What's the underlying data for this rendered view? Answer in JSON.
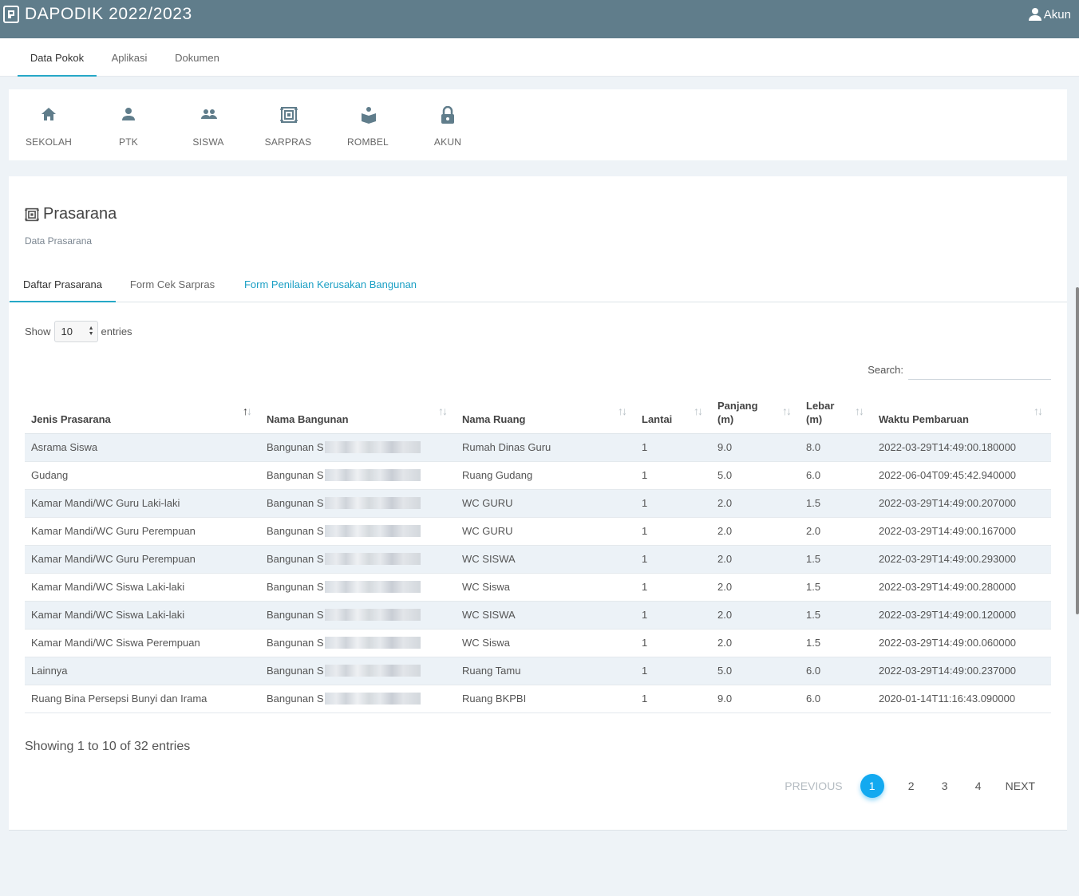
{
  "app": {
    "title": "DAPODIK 2022/2023",
    "account_label": "Akun",
    "colors": {
      "topbar": "#607d8b",
      "accent": "#26a8c7",
      "link": "#1a9fc4",
      "page_current": "#13a9f0"
    }
  },
  "menu": [
    {
      "label": "Data Pokok",
      "active": true
    },
    {
      "label": "Aplikasi",
      "active": false
    },
    {
      "label": "Dokumen",
      "active": false
    }
  ],
  "modules": [
    {
      "label": "SEKOLAH",
      "icon": "home-icon"
    },
    {
      "label": "PTK",
      "icon": "person-icon"
    },
    {
      "label": "SISWA",
      "icon": "people-icon"
    },
    {
      "label": "SARPRAS",
      "icon": "sarpras-icon"
    },
    {
      "label": "ROMBEL",
      "icon": "book-reader-icon"
    },
    {
      "label": "AKUN",
      "icon": "lock-icon"
    }
  ],
  "page": {
    "title": "Prasarana",
    "subtitle": "Data Prasarana"
  },
  "tabs": [
    {
      "label": "Daftar Prasarana",
      "active": true
    },
    {
      "label": "Form Cek Sarpras",
      "active": false
    },
    {
      "label": "Form Penilaian Kerusakan Bangunan",
      "active": false
    }
  ],
  "table_controls": {
    "show_label": "Show",
    "entries_value": "10",
    "entries_label": "entries",
    "search_label": "Search:",
    "search_value": ""
  },
  "table": {
    "columns": [
      "Jenis Prasarana",
      "Nama Bangunan",
      "Nama Ruang",
      "Lantai",
      "Panjang (m)",
      "Lebar (m)",
      "Waktu Pembaruan"
    ],
    "rows": [
      [
        "Asrama Siswa",
        "Bangunan S",
        "Rumah Dinas Guru",
        "1",
        "9.0",
        "8.0",
        "2022-03-29T14:49:00.180000"
      ],
      [
        "Gudang",
        "Bangunan S",
        "Ruang Gudang",
        "1",
        "5.0",
        "6.0",
        "2022-06-04T09:45:42.940000"
      ],
      [
        "Kamar Mandi/WC Guru Laki-laki",
        "Bangunan S",
        "WC GURU",
        "1",
        "2.0",
        "1.5",
        "2022-03-29T14:49:00.207000"
      ],
      [
        "Kamar Mandi/WC Guru Perempuan",
        "Bangunan S",
        "WC GURU",
        "1",
        "2.0",
        "2.0",
        "2022-03-29T14:49:00.167000"
      ],
      [
        "Kamar Mandi/WC Guru Perempuan",
        "Bangunan S",
        "WC SISWA",
        "1",
        "2.0",
        "1.5",
        "2022-03-29T14:49:00.293000"
      ],
      [
        "Kamar Mandi/WC Siswa Laki-laki",
        "Bangunan S",
        "WC Siswa",
        "1",
        "2.0",
        "1.5",
        "2022-03-29T14:49:00.280000"
      ],
      [
        "Kamar Mandi/WC Siswa Laki-laki",
        "Bangunan S",
        "WC SISWA",
        "1",
        "2.0",
        "1.5",
        "2022-03-29T14:49:00.120000"
      ],
      [
        "Kamar Mandi/WC Siswa Perempuan",
        "Bangunan S",
        "WC Siswa",
        "1",
        "2.0",
        "1.5",
        "2022-03-29T14:49:00.060000"
      ],
      [
        "Lainnya",
        "Bangunan S",
        "Ruang Tamu",
        "1",
        "5.0",
        "6.0",
        "2022-03-29T14:49:00.237000"
      ],
      [
        "Ruang Bina Persepsi Bunyi dan Irama",
        "Bangunan S",
        "Ruang BKPBI",
        "1",
        "9.0",
        "6.0",
        "2020-01-14T11:16:43.090000"
      ]
    ]
  },
  "info": "Showing 1 to 10 of 32 entries",
  "pagination": {
    "previous": "PREVIOUS",
    "pages": [
      "1",
      "2",
      "3",
      "4"
    ],
    "current": "1",
    "next": "NEXT"
  }
}
